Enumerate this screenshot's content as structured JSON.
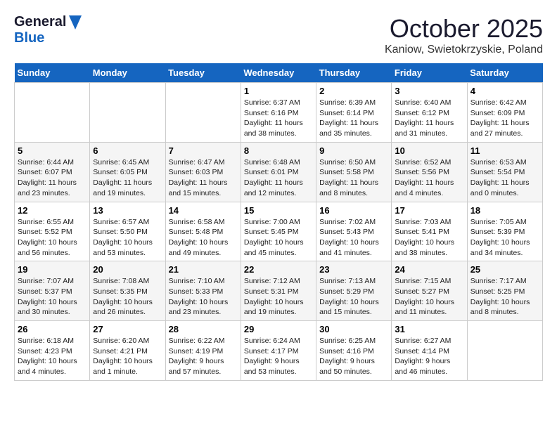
{
  "header": {
    "logo_general": "General",
    "logo_blue": "Blue",
    "month_title": "October 2025",
    "location": "Kaniow, Swietokrzyskie, Poland"
  },
  "weekdays": [
    "Sunday",
    "Monday",
    "Tuesday",
    "Wednesday",
    "Thursday",
    "Friday",
    "Saturday"
  ],
  "weeks": [
    [
      {
        "day": "",
        "info": ""
      },
      {
        "day": "",
        "info": ""
      },
      {
        "day": "",
        "info": ""
      },
      {
        "day": "1",
        "info": "Sunrise: 6:37 AM\nSunset: 6:16 PM\nDaylight: 11 hours\nand 38 minutes."
      },
      {
        "day": "2",
        "info": "Sunrise: 6:39 AM\nSunset: 6:14 PM\nDaylight: 11 hours\nand 35 minutes."
      },
      {
        "day": "3",
        "info": "Sunrise: 6:40 AM\nSunset: 6:12 PM\nDaylight: 11 hours\nand 31 minutes."
      },
      {
        "day": "4",
        "info": "Sunrise: 6:42 AM\nSunset: 6:09 PM\nDaylight: 11 hours\nand 27 minutes."
      }
    ],
    [
      {
        "day": "5",
        "info": "Sunrise: 6:44 AM\nSunset: 6:07 PM\nDaylight: 11 hours\nand 23 minutes."
      },
      {
        "day": "6",
        "info": "Sunrise: 6:45 AM\nSunset: 6:05 PM\nDaylight: 11 hours\nand 19 minutes."
      },
      {
        "day": "7",
        "info": "Sunrise: 6:47 AM\nSunset: 6:03 PM\nDaylight: 11 hours\nand 15 minutes."
      },
      {
        "day": "8",
        "info": "Sunrise: 6:48 AM\nSunset: 6:01 PM\nDaylight: 11 hours\nand 12 minutes."
      },
      {
        "day": "9",
        "info": "Sunrise: 6:50 AM\nSunset: 5:58 PM\nDaylight: 11 hours\nand 8 minutes."
      },
      {
        "day": "10",
        "info": "Sunrise: 6:52 AM\nSunset: 5:56 PM\nDaylight: 11 hours\nand 4 minutes."
      },
      {
        "day": "11",
        "info": "Sunrise: 6:53 AM\nSunset: 5:54 PM\nDaylight: 11 hours\nand 0 minutes."
      }
    ],
    [
      {
        "day": "12",
        "info": "Sunrise: 6:55 AM\nSunset: 5:52 PM\nDaylight: 10 hours\nand 56 minutes."
      },
      {
        "day": "13",
        "info": "Sunrise: 6:57 AM\nSunset: 5:50 PM\nDaylight: 10 hours\nand 53 minutes."
      },
      {
        "day": "14",
        "info": "Sunrise: 6:58 AM\nSunset: 5:48 PM\nDaylight: 10 hours\nand 49 minutes."
      },
      {
        "day": "15",
        "info": "Sunrise: 7:00 AM\nSunset: 5:45 PM\nDaylight: 10 hours\nand 45 minutes."
      },
      {
        "day": "16",
        "info": "Sunrise: 7:02 AM\nSunset: 5:43 PM\nDaylight: 10 hours\nand 41 minutes."
      },
      {
        "day": "17",
        "info": "Sunrise: 7:03 AM\nSunset: 5:41 PM\nDaylight: 10 hours\nand 38 minutes."
      },
      {
        "day": "18",
        "info": "Sunrise: 7:05 AM\nSunset: 5:39 PM\nDaylight: 10 hours\nand 34 minutes."
      }
    ],
    [
      {
        "day": "19",
        "info": "Sunrise: 7:07 AM\nSunset: 5:37 PM\nDaylight: 10 hours\nand 30 minutes."
      },
      {
        "day": "20",
        "info": "Sunrise: 7:08 AM\nSunset: 5:35 PM\nDaylight: 10 hours\nand 26 minutes."
      },
      {
        "day": "21",
        "info": "Sunrise: 7:10 AM\nSunset: 5:33 PM\nDaylight: 10 hours\nand 23 minutes."
      },
      {
        "day": "22",
        "info": "Sunrise: 7:12 AM\nSunset: 5:31 PM\nDaylight: 10 hours\nand 19 minutes."
      },
      {
        "day": "23",
        "info": "Sunrise: 7:13 AM\nSunset: 5:29 PM\nDaylight: 10 hours\nand 15 minutes."
      },
      {
        "day": "24",
        "info": "Sunrise: 7:15 AM\nSunset: 5:27 PM\nDaylight: 10 hours\nand 11 minutes."
      },
      {
        "day": "25",
        "info": "Sunrise: 7:17 AM\nSunset: 5:25 PM\nDaylight: 10 hours\nand 8 minutes."
      }
    ],
    [
      {
        "day": "26",
        "info": "Sunrise: 6:18 AM\nSunset: 4:23 PM\nDaylight: 10 hours\nand 4 minutes."
      },
      {
        "day": "27",
        "info": "Sunrise: 6:20 AM\nSunset: 4:21 PM\nDaylight: 10 hours\nand 1 minute."
      },
      {
        "day": "28",
        "info": "Sunrise: 6:22 AM\nSunset: 4:19 PM\nDaylight: 9 hours\nand 57 minutes."
      },
      {
        "day": "29",
        "info": "Sunrise: 6:24 AM\nSunset: 4:17 PM\nDaylight: 9 hours\nand 53 minutes."
      },
      {
        "day": "30",
        "info": "Sunrise: 6:25 AM\nSunset: 4:16 PM\nDaylight: 9 hours\nand 50 minutes."
      },
      {
        "day": "31",
        "info": "Sunrise: 6:27 AM\nSunset: 4:14 PM\nDaylight: 9 hours\nand 46 minutes."
      },
      {
        "day": "",
        "info": ""
      }
    ]
  ]
}
